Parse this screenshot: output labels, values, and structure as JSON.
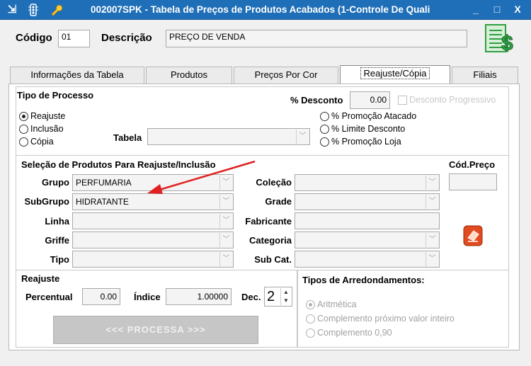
{
  "window": {
    "title": "002007SPK - Tabela de Preços de Produtos Acabados (1-Controle De Quali",
    "minimize": "_",
    "restore": "□",
    "close": "X"
  },
  "header": {
    "codigo_label": "Código",
    "codigo_value": "01",
    "descricao_label": "Descrição",
    "descricao_value": "PREÇO DE VENDA"
  },
  "tabs": [
    {
      "label": "Informações da Tabela"
    },
    {
      "label": "Produtos"
    },
    {
      "label": "Preços Por Cor"
    },
    {
      "label": "Reajuste/Cópia"
    },
    {
      "label": "Filiais"
    }
  ],
  "processo": {
    "title": "Tipo de Processo",
    "options": [
      "Reajuste",
      "Inclusão",
      "Cópia"
    ],
    "tabela_label": "Tabela",
    "desconto_label": "% Desconto",
    "desconto_value": "0.00",
    "desconto_progressivo": "Desconto Progressivo",
    "promo_options": [
      "% Promoção Atacado",
      "% Limite Desconto",
      "% Promoção Loja"
    ]
  },
  "selecao": {
    "title": "Seleção de Produtos Para Reajuste/Inclusão",
    "grupo_label": "Grupo",
    "grupo_value": "PERFUMARIA",
    "subgrupo_label": "SubGrupo",
    "subgrupo_value": "HIDRATANTE",
    "linha_label": "Linha",
    "griffe_label": "Griffe",
    "tipo_label": "Tipo",
    "colecao_label": "Coleção",
    "grade_label": "Grade",
    "fabricante_label": "Fabricante",
    "categoria_label": "Categoria",
    "subcat_label": "Sub Cat.",
    "cod_preco_label": "Cód.Preço"
  },
  "reajuste": {
    "title": "Reajuste",
    "percentual_label": "Percentual",
    "percentual_value": "0.00",
    "indice_label": "Índice",
    "indice_value": "1.00000",
    "dec_label": "Dec.",
    "dec_value": "2",
    "processa_label": "<<<  PROCESSA  >>>"
  },
  "arredondamentos": {
    "title": "Tipos de Arredondamentos:",
    "options": [
      "Aritmética",
      "Complemento próximo valor inteiro",
      "Complemento 0,90"
    ]
  },
  "colors": {
    "titlebar": "#1f6fb8",
    "arrow": "#e02020",
    "money_icon": "#2ea043"
  }
}
